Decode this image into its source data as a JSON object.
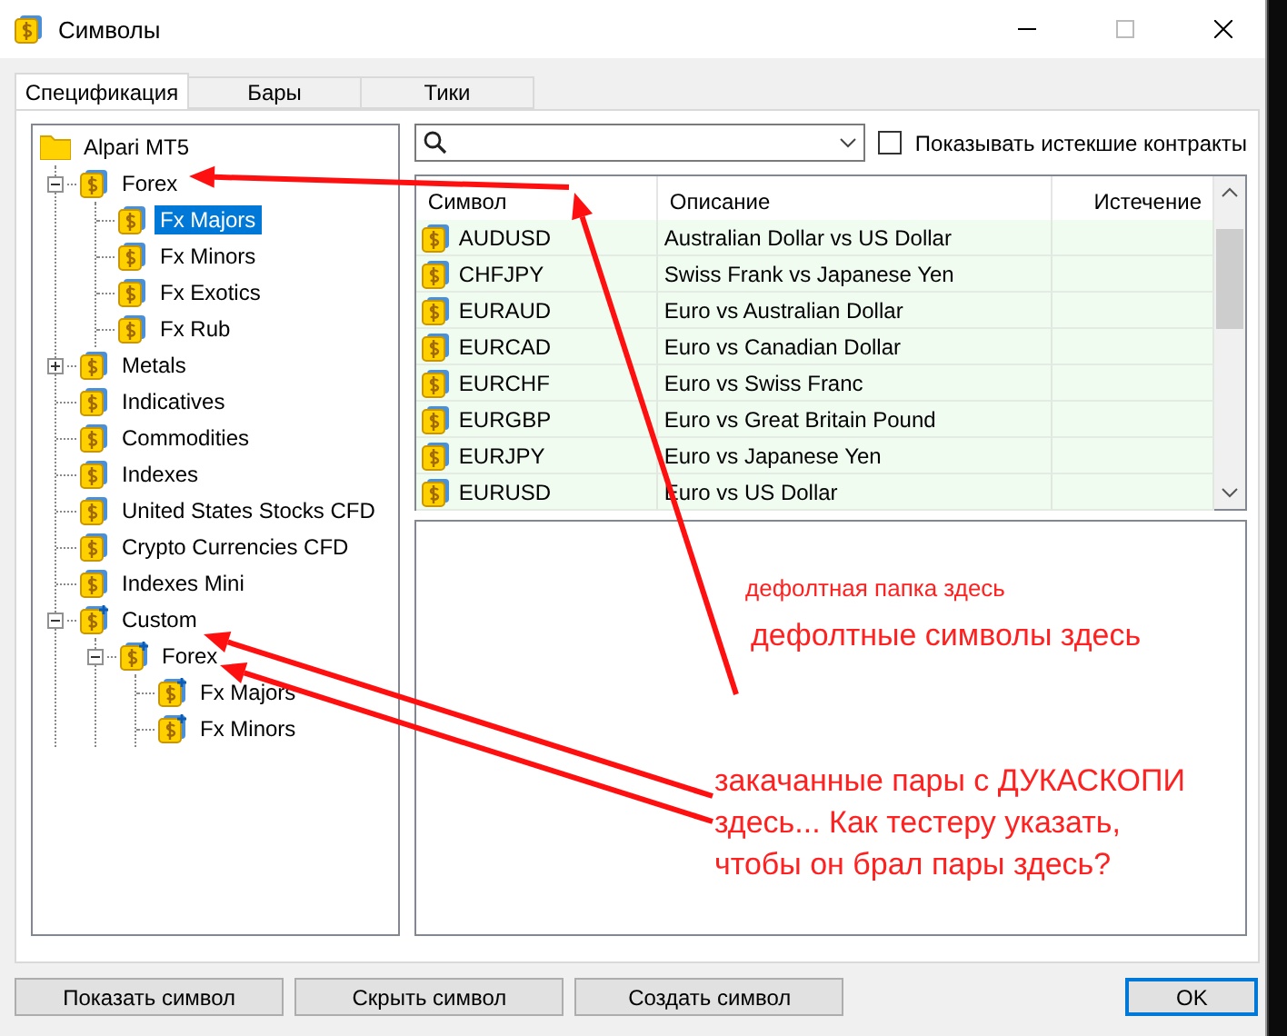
{
  "window": {
    "title": "Символы"
  },
  "tabs": [
    {
      "label": "Спецификация",
      "selected": true
    },
    {
      "label": "Бары",
      "selected": false
    },
    {
      "label": "Тики",
      "selected": false
    }
  ],
  "tree": [
    {
      "label": "Alpari MT5",
      "kind": "folder",
      "selected": false,
      "children": [
        {
          "label": "Forex",
          "kind": "symbols",
          "expanded": true,
          "selected": false,
          "children": [
            {
              "label": "Fx Majors",
              "kind": "symbols",
              "selected": true
            },
            {
              "label": "Fx Minors",
              "kind": "symbols",
              "selected": false
            },
            {
              "label": "Fx Exotics",
              "kind": "symbols",
              "selected": false
            },
            {
              "label": "Fx Rub",
              "kind": "symbols",
              "selected": false
            }
          ]
        },
        {
          "label": "Metals",
          "kind": "symbols",
          "expanded": false,
          "selected": false
        },
        {
          "label": "Indicatives",
          "kind": "symbols",
          "selected": false
        },
        {
          "label": "Commodities",
          "kind": "symbols",
          "selected": false
        },
        {
          "label": "Indexes",
          "kind": "symbols",
          "selected": false
        },
        {
          "label": "United States Stocks CFD",
          "kind": "symbols",
          "selected": false
        },
        {
          "label": "Crypto Currencies CFD",
          "kind": "symbols",
          "selected": false
        },
        {
          "label": "Indexes Mini",
          "kind": "symbols",
          "selected": false
        },
        {
          "label": "Custom",
          "kind": "custom",
          "expanded": true,
          "selected": false,
          "children": [
            {
              "label": "Forex",
              "kind": "custom",
              "expanded": true,
              "selected": false,
              "children": [
                {
                  "label": "Fx Majors",
                  "kind": "custom",
                  "selected": false
                },
                {
                  "label": "Fx Minors",
                  "kind": "custom",
                  "selected": false
                }
              ]
            }
          ]
        }
      ]
    }
  ],
  "show_expired": {
    "label": "Показывать истекшие контракты",
    "checked": false
  },
  "table": {
    "columns": [
      "Символ",
      "Описание",
      "Истечение"
    ],
    "rows": [
      {
        "symbol": "AUDUSD",
        "description": "Australian Dollar vs US Dollar"
      },
      {
        "symbol": "CHFJPY",
        "description": "Swiss Frank vs Japanese Yen"
      },
      {
        "symbol": "EURAUD",
        "description": "Euro vs Australian Dollar"
      },
      {
        "symbol": "EURCAD",
        "description": "Euro vs Canadian Dollar"
      },
      {
        "symbol": "EURCHF",
        "description": "Euro vs Swiss Franc"
      },
      {
        "symbol": "EURGBP",
        "description": "Euro vs Great Britain Pound"
      },
      {
        "symbol": "EURJPY",
        "description": "Euro vs Japanese Yen"
      },
      {
        "symbol": "EURUSD",
        "description": "Euro vs US Dollar"
      }
    ]
  },
  "buttons": [
    {
      "label": "Показать символ",
      "kind": "normal"
    },
    {
      "label": "Скрыть символ",
      "kind": "normal"
    },
    {
      "label": "Создать символ",
      "kind": "normal"
    },
    {
      "label": "OK",
      "kind": "default"
    }
  ],
  "annotations": [
    {
      "text": "дефолтная папка здесь",
      "kind": "small"
    },
    {
      "text": "дефолтные символы здесь",
      "kind": "large"
    },
    {
      "text": "закачанные пары с ДУКАСКОПИ здесь... Как тестеру указать, чтобы он брал пары здесь?",
      "kind": "large"
    }
  ]
}
